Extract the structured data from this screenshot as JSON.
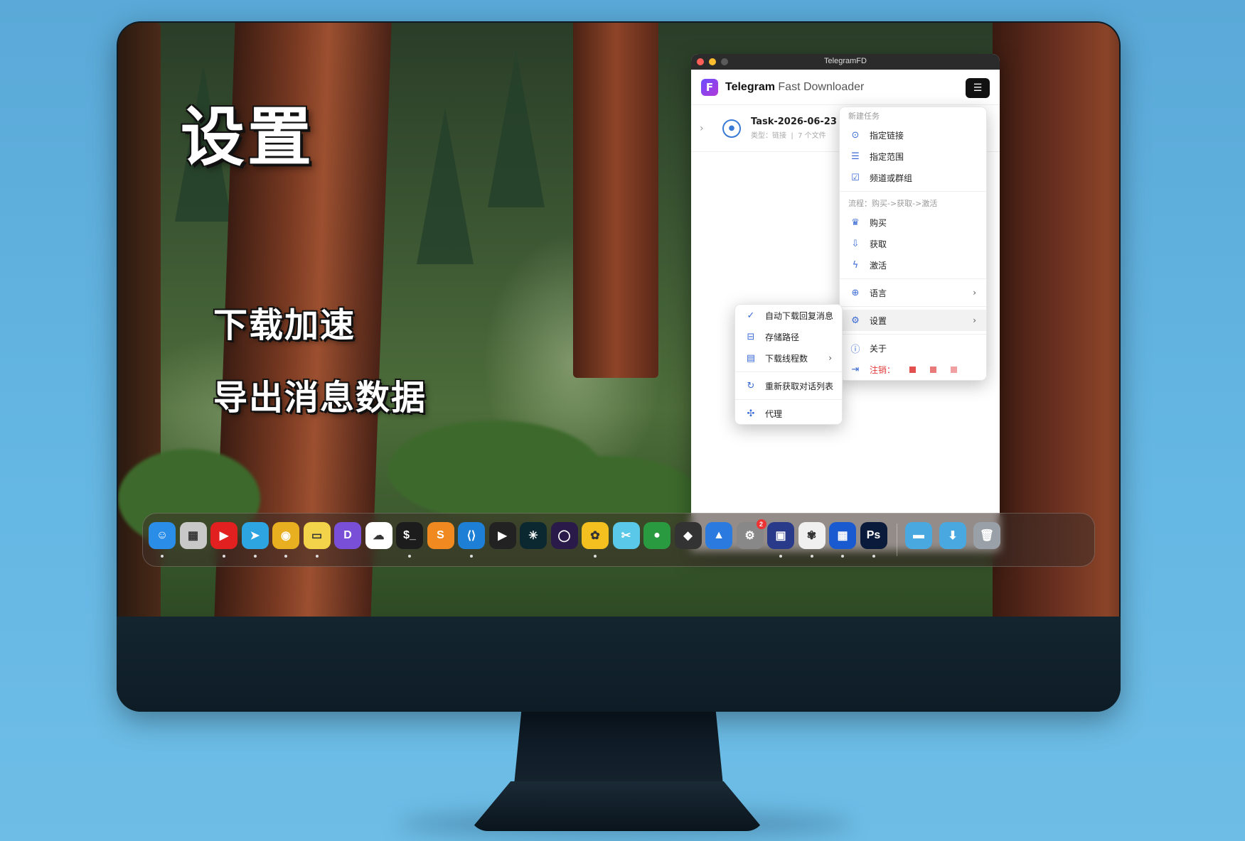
{
  "overlay": {
    "title": "设置",
    "sub1": "下载加速",
    "sub2": "导出消息数据"
  },
  "window": {
    "title": "TelegramFD",
    "app_name_bold": "Telegram",
    "app_name_rest": " Fast Downloader",
    "menu_button": "☰"
  },
  "task": {
    "name": "Task-2026-06-23",
    "type_label": "类型：链接",
    "files_label": "7 个文件"
  },
  "main_menu": {
    "new_task_header": "新建任务",
    "items_new": [
      {
        "icon": "link-circle-icon",
        "glyph": "⊙",
        "label": "指定链接"
      },
      {
        "icon": "range-icon",
        "glyph": "☰",
        "label": "指定范围"
      },
      {
        "icon": "channel-icon",
        "glyph": "☑",
        "label": "频道或群组"
      }
    ],
    "flow_header": "流程：购买->获取->激活",
    "items_flow": [
      {
        "icon": "crown-icon",
        "glyph": "♛",
        "label": "购买"
      },
      {
        "icon": "download-box-icon",
        "glyph": "⇩",
        "label": "获取"
      },
      {
        "icon": "bolt-icon",
        "glyph": "ϟ",
        "label": "激活"
      }
    ],
    "language": {
      "icon": "globe-icon",
      "glyph": "⊕",
      "label": "语言"
    },
    "settings": {
      "icon": "gear-icon",
      "glyph": "⚙",
      "label": "设置"
    },
    "about": {
      "icon": "info-icon",
      "glyph": "ⓘ",
      "label": "关于"
    },
    "logout": {
      "icon": "logout-icon",
      "glyph": "⇥",
      "label": "注销："
    }
  },
  "settings_menu": {
    "items": [
      {
        "icon": "check-icon",
        "glyph": "✓",
        "label": "自动下载回复消息"
      },
      {
        "icon": "storage-icon",
        "glyph": "⊟",
        "label": "存储路径"
      },
      {
        "icon": "threads-icon",
        "glyph": "▤",
        "label": "下载线程数"
      },
      {
        "icon": "refresh-icon",
        "glyph": "↻",
        "label": "重新获取对话列表"
      },
      {
        "icon": "proxy-icon",
        "glyph": "✣",
        "label": "代理"
      }
    ]
  },
  "dock": {
    "apps": [
      {
        "name": "finder",
        "glyph": "☺",
        "color": "#2a8de8",
        "dot": true
      },
      {
        "name": "launchpad",
        "glyph": "▦",
        "color": "#c8c8c8",
        "dot": false
      },
      {
        "name": "youtube-music",
        "glyph": "▶",
        "color": "#e32020",
        "dot": true
      },
      {
        "name": "telegram",
        "glyph": "➤",
        "color": "#2ca5e0",
        "dot": true
      },
      {
        "name": "chrome",
        "glyph": "◉",
        "color": "#e8b020",
        "dot": true
      },
      {
        "name": "notes",
        "glyph": "▭",
        "color": "#f3d34a",
        "dot": true
      },
      {
        "name": "d-app",
        "glyph": "D",
        "color": "#7a4fd8",
        "dot": false
      },
      {
        "name": "cloud-app",
        "glyph": "☁",
        "color": "#ffffff",
        "dot": false
      },
      {
        "name": "terminal",
        "glyph": "$_",
        "color": "#1c1c1c",
        "dot": true
      },
      {
        "name": "sublime-text",
        "glyph": "S",
        "color": "#f08a20",
        "dot": false
      },
      {
        "name": "vscode",
        "glyph": "⟨⟩",
        "color": "#1e7fd6",
        "dot": true
      },
      {
        "name": "final-cut",
        "glyph": "▶",
        "color": "#222222",
        "dot": false
      },
      {
        "name": "perplexity",
        "glyph": "✳",
        "color": "#0b2830",
        "dot": false
      },
      {
        "name": "circle-app",
        "glyph": "◯",
        "color": "#2a1a4a",
        "dot": false
      },
      {
        "name": "paw-app",
        "glyph": "✿",
        "color": "#f4c020",
        "dot": true
      },
      {
        "name": "scissors-app",
        "glyph": "✂",
        "color": "#5ac8e8",
        "dot": false
      },
      {
        "name": "green-app",
        "glyph": "●",
        "color": "#2a9a40",
        "dot": false
      },
      {
        "name": "diamond-app",
        "glyph": "◆",
        "color": "#333333",
        "dot": false
      },
      {
        "name": "mountain-app",
        "glyph": "▲",
        "color": "#2a7ae0",
        "dot": false
      },
      {
        "name": "system-settings",
        "glyph": "⚙",
        "color": "#888888",
        "dot": false,
        "badge": "2"
      },
      {
        "name": "frame-app",
        "glyph": "▣",
        "color": "#2a3a8a",
        "dot": true
      },
      {
        "name": "photos",
        "glyph": "✾",
        "color": "#f0f0f0",
        "dot": true
      },
      {
        "name": "grid-app",
        "glyph": "▦",
        "color": "#1a5ad0",
        "dot": true
      },
      {
        "name": "photoshop",
        "glyph": "Ps",
        "color": "#0a1a3a",
        "dot": true
      }
    ],
    "folders": [
      {
        "name": "folder",
        "glyph": "▬",
        "color": "#4aa8e0"
      },
      {
        "name": "downloads-folder",
        "glyph": "⬇",
        "color": "#4aa8e0"
      },
      {
        "name": "trash",
        "glyph": "🗑",
        "color": "#9aa0a8"
      }
    ]
  }
}
